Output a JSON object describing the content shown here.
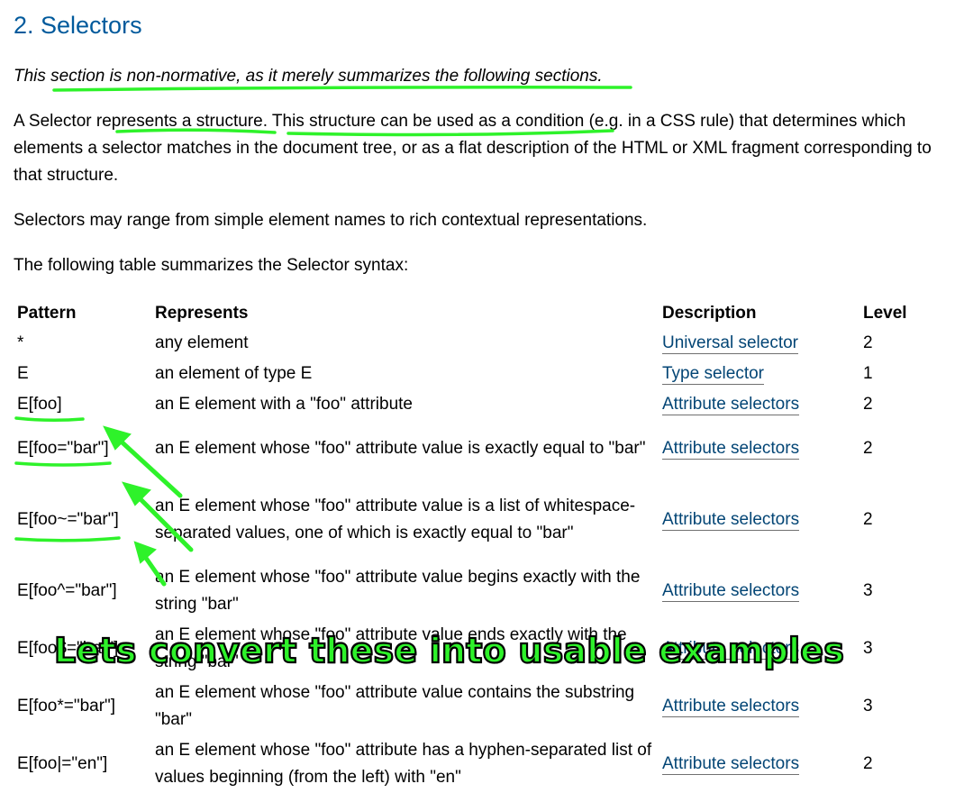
{
  "section": {
    "title": "2. Selectors",
    "note": "This section is non-normative, as it merely summarizes the following sections.",
    "definition": "A Selector represents a structure. This structure can be used as a condition (e.g. in a CSS rule) that determines which elements a selector matches in the document tree, or as a flat description of the HTML or XML fragment corresponding to that structure.",
    "range": "Selectors may range from simple element names to rich contextual representations.",
    "table_intro": "The following table summarizes the Selector syntax:"
  },
  "table": {
    "headers": [
      "Pattern",
      "Represents",
      "Description",
      "Level"
    ],
    "rows": [
      {
        "pattern": "*",
        "represents": "any element",
        "description": "Universal selector",
        "level": "2"
      },
      {
        "pattern": "E",
        "represents": "an element of type E",
        "description": "Type selector",
        "level": "1"
      },
      {
        "pattern": "E[foo]",
        "represents": "an E element with a \"foo\" attribute",
        "description": "Attribute selectors",
        "level": "2"
      },
      {
        "pattern": "E[foo=\"bar\"]",
        "represents": "an E element whose \"foo\" attribute value is exactly equal to \"bar\"",
        "description": "Attribute selectors",
        "level": "2"
      },
      {
        "pattern": "E[foo~=\"bar\"]",
        "represents": "an E element whose \"foo\" attribute value is a list of whitespace-separated values, one of which is exactly equal to \"bar\"",
        "description": "Attribute selectors",
        "level": "2"
      },
      {
        "pattern": "E[foo^=\"bar\"]",
        "represents": "an E element whose \"foo\" attribute value begins exactly with the string \"bar\"",
        "description": "Attribute selectors",
        "level": "3"
      },
      {
        "pattern": "E[foo$=\"bar\"]",
        "represents": "an E element whose \"foo\" attribute value ends exactly with the string \"bar\"",
        "description": "Attribute selectors",
        "level": "3"
      },
      {
        "pattern": "E[foo*=\"bar\"]",
        "represents": "an E element whose \"foo\" attribute value contains the substring \"bar\"",
        "description": "Attribute selectors",
        "level": "3"
      },
      {
        "pattern": "E[foo|=\"en\"]",
        "represents": "an E element whose \"foo\" attribute has a hyphen-separated list of values beginning (from the left) with \"en\"",
        "description": "Attribute selectors",
        "level": "2"
      }
    ]
  },
  "annotation": {
    "caption": "Lets convert these into usable examples",
    "color": "#2ef22a"
  }
}
